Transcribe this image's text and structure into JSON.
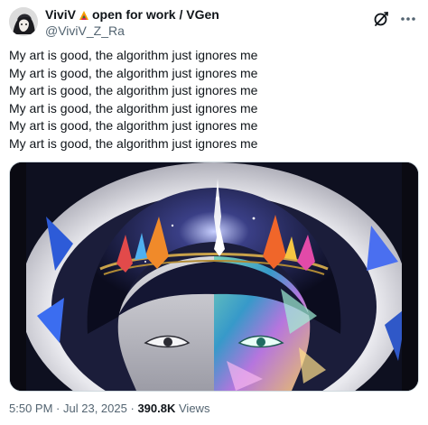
{
  "author": {
    "display_name_prefix": "ViviV",
    "display_name_suffix": "open for work / VGen",
    "badge_icon": "palette-emoji-icon",
    "handle": "@ViviV_Z_Ra"
  },
  "actions": {
    "grok_icon": "grok-icon",
    "more_icon": "more-icon"
  },
  "post": {
    "lines": [
      "My art is good, the algorithm just ignores me",
      "My art is good, the algorithm just ignores me",
      "My art is good, the algorithm just ignores me",
      "My art is good, the algorithm just ignores me",
      "My art is good, the algorithm just ignores me",
      "My art is good, the algorithm just ignores me"
    ]
  },
  "meta": {
    "time": "5:50 PM",
    "separator": "·",
    "date": "Jul 23, 2025",
    "views_count": "390.8K",
    "views_label": "Views"
  },
  "colors": {
    "text": "#0f1419",
    "muted": "#536471",
    "border": "#cfd9de"
  }
}
